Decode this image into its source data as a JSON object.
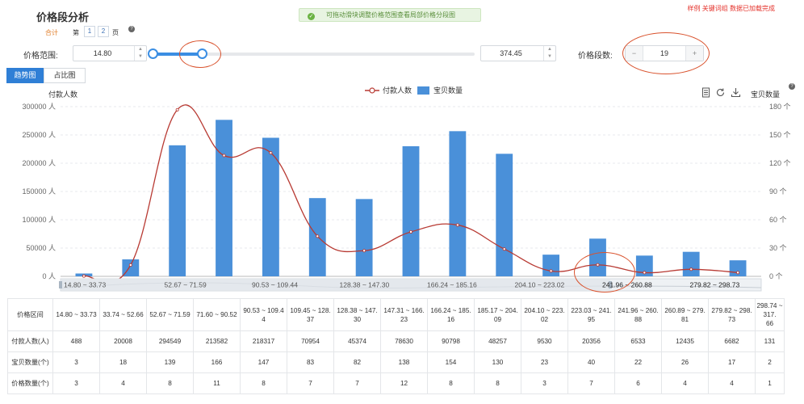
{
  "header": {
    "title": "价格段分析",
    "notice": "可拖动滑块调整价格范围查看局部价格分段图",
    "top_right": "样例 关键词组 数据已加载完成",
    "total_label": "合计",
    "page_prefix": "第",
    "pages": [
      "1",
      "2"
    ],
    "page_suffix": "页"
  },
  "controls": {
    "range_label": "价格范围:",
    "min_value": "14.80",
    "max_value": "374.45",
    "segments_label": "价格段数:",
    "segments_value": "19",
    "minus": "−",
    "plus": "+",
    "slider_fraction_start": 0.0,
    "slider_fraction_end": 0.15
  },
  "tabs": [
    "趋势图",
    "占比图"
  ],
  "toolbar": {
    "icons": [
      "document-icon",
      "refresh-icon",
      "download-icon"
    ],
    "right_label": "宝贝数量"
  },
  "chart_data": {
    "type": "bar",
    "y_left_label": "付款人数",
    "y_left_ticks": [
      "0 人",
      "50000 人",
      "100000 人",
      "150000 人",
      "200000 人",
      "250000 人",
      "300000 人"
    ],
    "y_right_ticks": [
      "0 个",
      "30 个",
      "60 个",
      "90 个",
      "120 个",
      "150 个",
      "180 个"
    ],
    "ylim_left": [
      0,
      300000
    ],
    "ylim_right": [
      0,
      180
    ],
    "legend": {
      "line": "付款人数",
      "bar": "宝贝数量"
    },
    "categories": [
      "14.80 ~ 33.73",
      "33.74 ~ 52.66",
      "52.67 ~ 71.59",
      "71.60 ~ 90.52",
      "90.53 ~ 109.44",
      "109.45 ~ 128.37",
      "128.38 ~ 147.30",
      "147.31 ~ 166.23",
      "166.24 ~ 185.16",
      "185.17 ~ 204.09",
      "204.10 ~ 223.02",
      "223.03 ~ 241.95",
      "241.96 ~ 260.88",
      "260.89 ~ 279.81",
      "279.82 ~ 298.73"
    ],
    "series": [
      {
        "name": "宝贝数量",
        "type": "bar",
        "axis": "right",
        "color": "#4a90d9",
        "values": [
          3,
          18,
          139,
          166,
          147,
          83,
          82,
          138,
          154,
          130,
          23,
          40,
          22,
          26,
          17
        ]
      },
      {
        "name": "付款人数",
        "type": "line",
        "axis": "left",
        "color": "#b83a33",
        "values": [
          488,
          20008,
          294549,
          213582,
          218317,
          70954,
          45374,
          78630,
          90798,
          48257,
          9530,
          20356,
          6533,
          12435,
          6682
        ]
      }
    ],
    "zoom_labels": [
      "14.80 ~ 33.73",
      "52.67 ~ 71.59",
      "90.53 ~ 109.44",
      "128.38 ~ 147.30",
      "166.24 ~ 185.16",
      "204.10 ~ 223.02",
      "241.96 ~ 260.88",
      "279.82 ~ 298.73"
    ]
  },
  "table": {
    "row_labels": [
      "价格区间",
      "付款人数(人)",
      "宝贝数量(个)",
      "价格数量(个)"
    ],
    "ranges": [
      [
        "14.80 ~ 33.73"
      ],
      [
        "33.74 ~ 52.66"
      ],
      [
        "52.67 ~ 71.59"
      ],
      [
        "71.60 ~ 90.52"
      ],
      [
        "90.53 ~ 109.4",
        "4"
      ],
      [
        "109.45 ~ 128.",
        "37"
      ],
      [
        "128.38 ~ 147.",
        "30"
      ],
      [
        "147.31 ~ 166.",
        "23"
      ],
      [
        "166.24 ~ 185.",
        "16"
      ],
      [
        "185.17 ~ 204.",
        "09"
      ],
      [
        "204.10 ~ 223.",
        "02"
      ],
      [
        "223.03 ~ 241.",
        "95"
      ],
      [
        "241.96 ~ 260.",
        "88"
      ],
      [
        "260.89 ~ 279.",
        "81"
      ],
      [
        "279.82 ~ 298.",
        "73"
      ],
      [
        "298.74 ~ 317.",
        "66"
      ]
    ],
    "buyers": [
      "488",
      "20008",
      "294549",
      "213582",
      "218317",
      "70954",
      "45374",
      "78630",
      "90798",
      "48257",
      "9530",
      "20356",
      "6533",
      "12435",
      "6682",
      "131"
    ],
    "items": [
      "3",
      "18",
      "139",
      "166",
      "147",
      "83",
      "82",
      "138",
      "154",
      "130",
      "23",
      "40",
      "22",
      "26",
      "17",
      "2"
    ],
    "price_counts": [
      "3",
      "4",
      "8",
      "11",
      "8",
      "7",
      "7",
      "12",
      "8",
      "8",
      "3",
      "7",
      "6",
      "4",
      "4",
      "1"
    ]
  }
}
